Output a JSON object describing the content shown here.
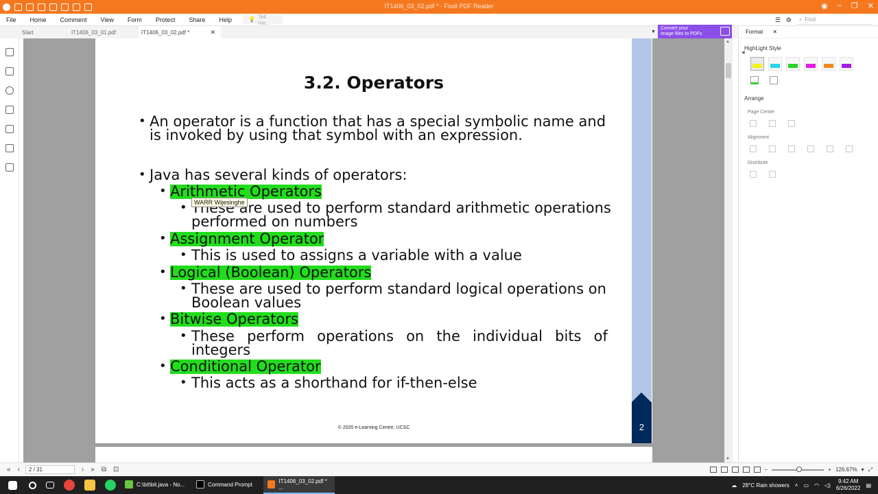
{
  "window": {
    "title": "IT1406_03_02.pdf * - Foxit PDF Reader"
  },
  "menu": [
    "File",
    "Home",
    "Comment",
    "View",
    "Form",
    "Protect",
    "Share",
    "Help"
  ],
  "tell_me_placeholder": "Tell me...",
  "find_placeholder": "Find",
  "tabs": {
    "start": "Start",
    "doc1": "IT1406_03_01.pdf",
    "doc2": "IT1406_03_02.pdf *"
  },
  "promo": {
    "line1": "Convert your",
    "line2": "image files to PDFs"
  },
  "slide": {
    "title": "3.2. Operators",
    "intro_line1": "An operator is a function that has a special symbolic name and",
    "intro_line2": "is invoked by using that symbol with an expression.",
    "kinds": "Java has several kinds of operators:",
    "items": [
      {
        "name": "Arithmetic Operators",
        "desc1": "These are used to perform standard arithmetic operations",
        "desc2": "performed on numbers"
      },
      {
        "name": "Assignment Operator",
        "desc1": "This is used to assigns a variable with a value"
      },
      {
        "name": "Logical (Boolean) Operators",
        "desc1": "These are used to perform standard logical operations on",
        "desc2": "Boolean values"
      },
      {
        "name": "Bitwise Operators",
        "desc1": "These perform operations on the individual bits of",
        "desc2": "integers"
      },
      {
        "name": "Conditional Operator",
        "desc1": "This acts as a shorthand for if-then-else"
      }
    ],
    "justify_words": [
      "These",
      "perform",
      "operations",
      "on",
      "the",
      "individual",
      "bits",
      "of"
    ],
    "footer": "© 2020 e-Learning Centre, UCSC",
    "page_number": "2",
    "tooltip": "WARR Wijesinghe"
  },
  "panel": {
    "tab": "Format",
    "highlight_style": "HighLight Style",
    "arrange": "Arrange",
    "page_center": "Page Center",
    "alignment": "Alignment",
    "distribute": "Distribute",
    "swatch_colors": [
      "#f2f21b",
      "#2ad4f2",
      "#2bd42b",
      "#e41be4",
      "#f08a1e",
      "#a31be4"
    ]
  },
  "status": {
    "page_display": "2 / 31",
    "zoom": "126.67%"
  },
  "taskbar": {
    "apps": [
      "C:\\bit\\bit.java - No...",
      "Command Prompt",
      "IT1406_03_02.pdf * ..."
    ],
    "weather": "28°C  Rain showers",
    "time": "9:42 AM",
    "date": "6/26/2022"
  }
}
